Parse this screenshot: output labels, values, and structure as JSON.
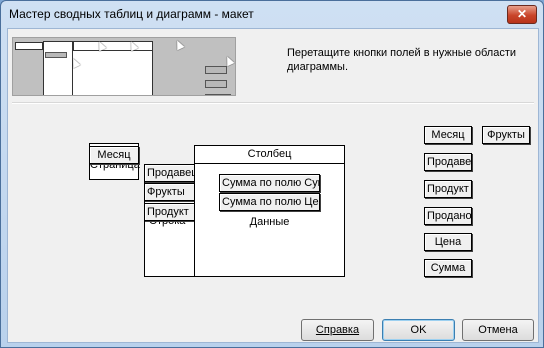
{
  "window": {
    "title": "Мастер сводных таблиц и диаграмм - макет",
    "close_glyph": "✕"
  },
  "instruction": "Перетащите кнопки полей в нужные области диаграммы.",
  "layout": {
    "page_area": {
      "label": "Страница",
      "field": "Месяц"
    },
    "row_area": {
      "label": "Строка",
      "fields": [
        "Продавец",
        "Фрукты",
        "Продукт"
      ]
    },
    "column_area": {
      "label": "Столбец"
    },
    "data_area": {
      "label": "Данные",
      "fields": [
        "Сумма по полю Сумма",
        "Сумма по полю Цена"
      ]
    }
  },
  "available_fields": [
    "Месяц",
    "Фрукты",
    "Продавец",
    "Продукт",
    "Продано,",
    "Цена",
    "Сумма"
  ],
  "buttons": {
    "help": "Справка",
    "ok": "OK",
    "cancel": "Отмена"
  },
  "colors": {
    "titlebar": "#b9d1ec",
    "close": "#c9452a",
    "preview_bg": "#c0c0c0"
  },
  "icons": [
    "close-icon",
    "cursor-icon"
  ]
}
